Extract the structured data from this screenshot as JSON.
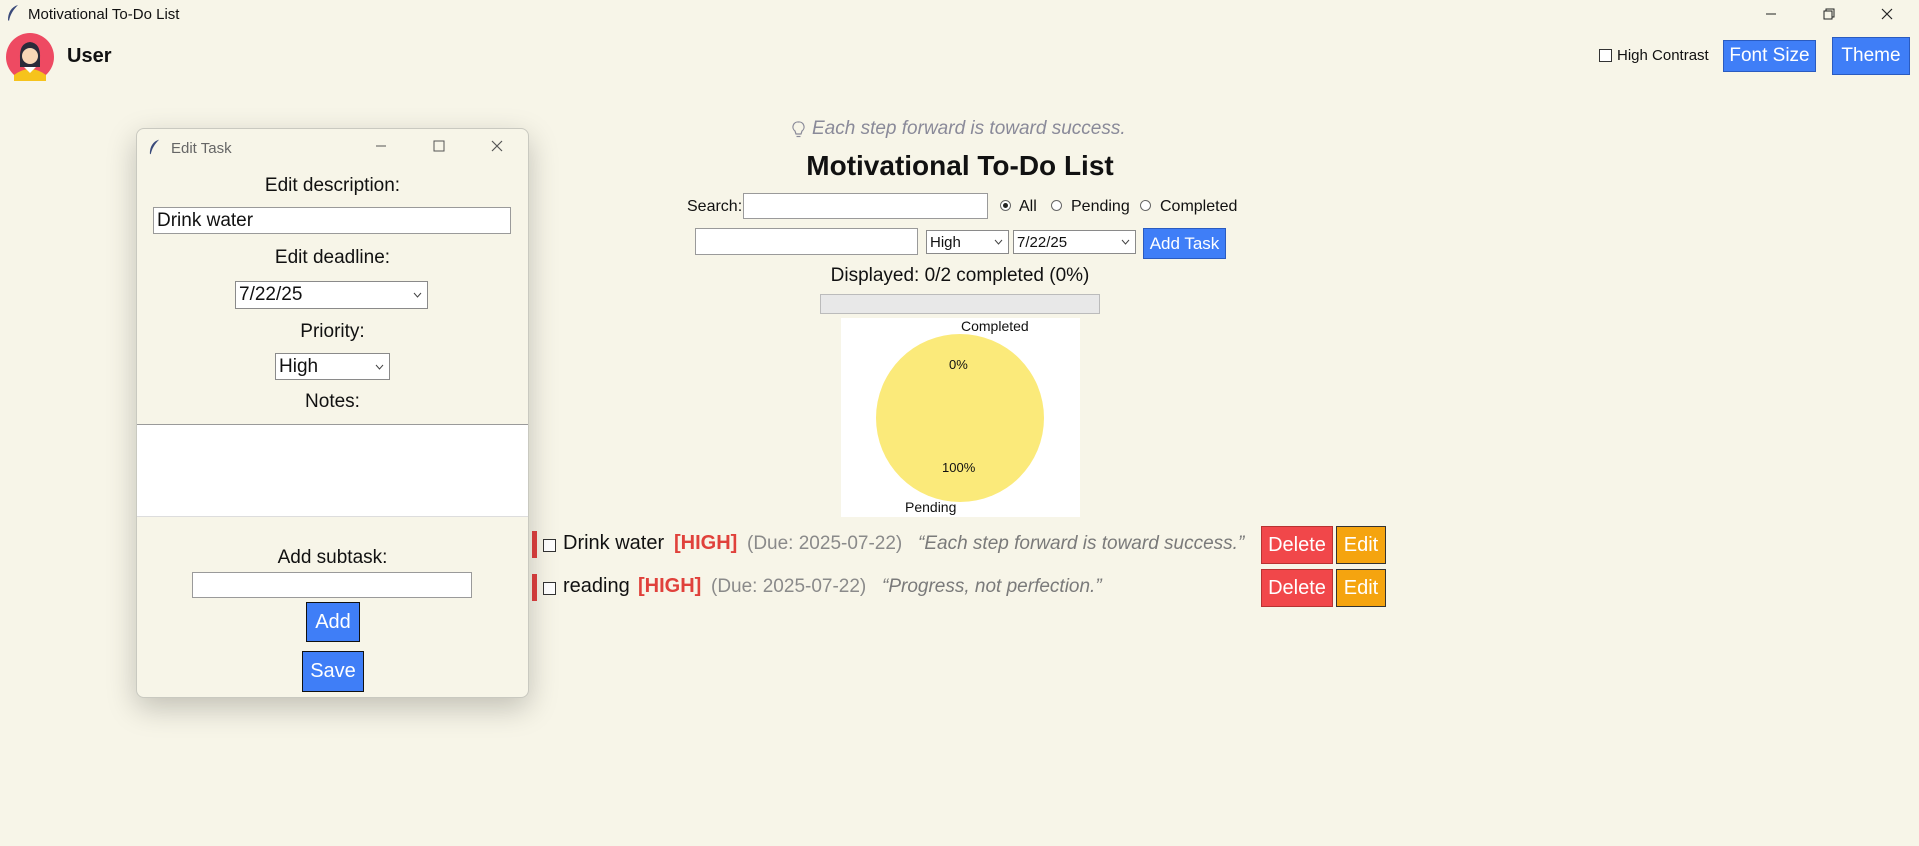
{
  "window": {
    "title": "Motivational To-Do List"
  },
  "header": {
    "username": "User",
    "high_contrast_label": "High Contrast",
    "font_size_label": "Font Size",
    "theme_label": "Theme"
  },
  "main": {
    "quote": "Each step forward is toward success.",
    "title": "Motivational To-Do List",
    "search_label": "Search:",
    "filters": {
      "all": "All",
      "pending": "Pending",
      "completed": "Completed",
      "selected": "All"
    },
    "new_task": {
      "priority": "High",
      "date": "7/22/25",
      "add_label": "Add Task"
    },
    "progress_text": "Displayed: 0/2 completed (0%)",
    "progress_fraction": 0
  },
  "chart_data": {
    "type": "pie",
    "labels": [
      "Completed",
      "Pending"
    ],
    "values": [
      0,
      100
    ],
    "value_labels": [
      "0%",
      "100%"
    ],
    "colors": [
      "#3f7ef7",
      "#fbea7a"
    ]
  },
  "tasks": [
    {
      "name": "Drink water",
      "priority": "[HIGH]",
      "due": "(Due: 2025-07-22)",
      "quote": "“Each step forward is toward success.”",
      "delete_label": "Delete",
      "edit_label": "Edit"
    },
    {
      "name": "reading",
      "priority": "[HIGH]",
      "due": "(Due: 2025-07-22)",
      "quote": "“Progress, not perfection.”",
      "delete_label": "Delete",
      "edit_label": "Edit"
    }
  ],
  "dialog": {
    "title": "Edit Task",
    "desc_label": "Edit description:",
    "desc_value": "Drink water",
    "deadline_label": "Edit deadline:",
    "deadline_value": "7/22/25",
    "priority_label": "Priority:",
    "priority_value": "High",
    "notes_label": "Notes:",
    "subtask_label": "Add subtask:",
    "add_label": "Add",
    "save_label": "Save"
  },
  "colors": {
    "accent": "#3f7ef7",
    "danger": "#f1474a",
    "warning": "#f5a40f",
    "priority_high": "#e0413b",
    "background": "#f7f5e8"
  }
}
